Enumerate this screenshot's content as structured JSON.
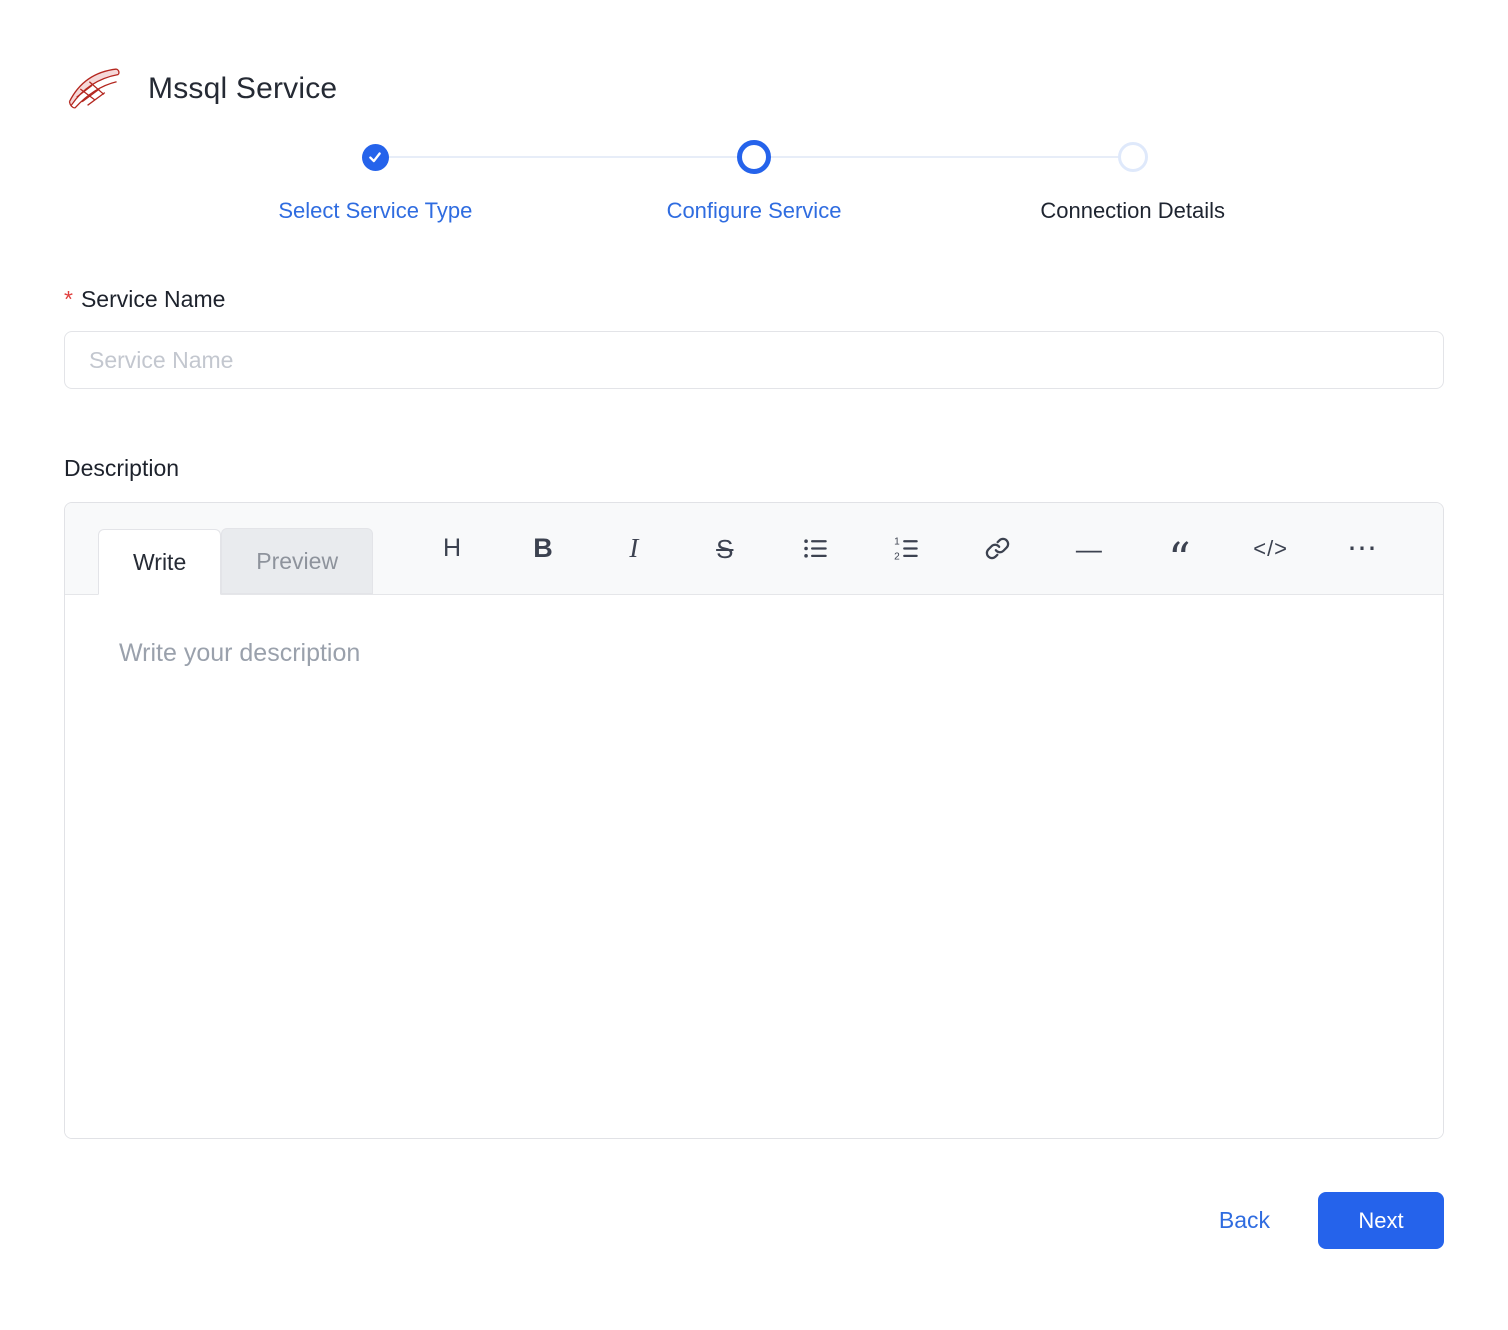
{
  "header": {
    "title": "Mssql Service",
    "logo": "mssql-logo"
  },
  "stepper": {
    "steps": [
      {
        "label": "Select Service Type",
        "state": "completed"
      },
      {
        "label": "Configure Service",
        "state": "active"
      },
      {
        "label": "Connection Details",
        "state": "pending"
      }
    ]
  },
  "form": {
    "service_name": {
      "required_marker": "*",
      "label": "Service Name",
      "placeholder": "Service Name",
      "value": ""
    },
    "description": {
      "label": "Description",
      "placeholder": "Write your description",
      "value": "",
      "tabs": [
        {
          "label": "Write",
          "active": true
        },
        {
          "label": "Preview",
          "active": false
        }
      ],
      "toolbar": [
        {
          "name": "heading",
          "glyph": "H"
        },
        {
          "name": "bold",
          "glyph": "B"
        },
        {
          "name": "italic",
          "glyph": "I"
        },
        {
          "name": "strikethrough",
          "glyph": "S"
        },
        {
          "name": "unordered-list",
          "glyph": ""
        },
        {
          "name": "ordered-list",
          "glyph": ""
        },
        {
          "name": "link",
          "glyph": ""
        },
        {
          "name": "horizontal-rule",
          "glyph": "—"
        },
        {
          "name": "quote",
          "glyph": "“"
        },
        {
          "name": "code",
          "glyph": "</>"
        },
        {
          "name": "more",
          "glyph": "⋯"
        }
      ]
    }
  },
  "footer": {
    "back_label": "Back",
    "next_label": "Next"
  },
  "colors": {
    "accent": "#2563eb",
    "link_blue": "#2f6ce0",
    "required_red": "#e0403f",
    "logo_red": "#b3261e",
    "pending_ring": "#dfe9fb"
  }
}
